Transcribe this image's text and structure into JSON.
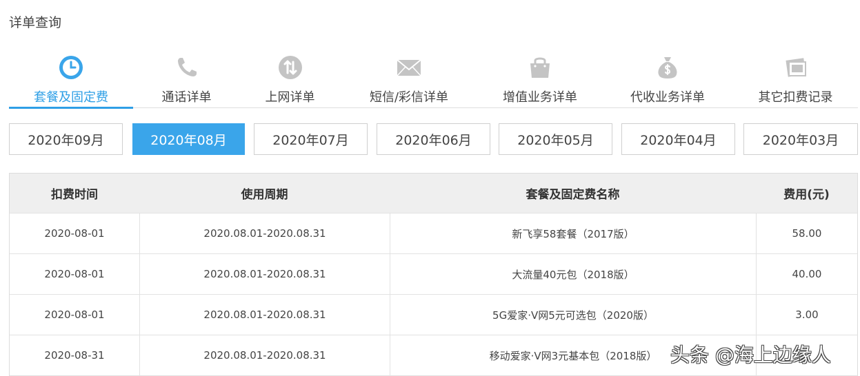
{
  "page_title": "详单查询",
  "tabs": [
    {
      "label": "套餐及固定费",
      "icon": "clock-icon",
      "active": true
    },
    {
      "label": "通话详单",
      "icon": "phone-icon",
      "active": false
    },
    {
      "label": "上网详单",
      "icon": "data-transfer-icon",
      "active": false
    },
    {
      "label": "短信/彩信详单",
      "icon": "envelope-icon",
      "active": false
    },
    {
      "label": "增值业务详单",
      "icon": "shopping-bag-icon",
      "active": false
    },
    {
      "label": "代收业务详单",
      "icon": "money-bag-icon",
      "active": false
    },
    {
      "label": "其它扣费记录",
      "icon": "receipt-icon",
      "active": false
    }
  ],
  "months": [
    {
      "label": "2020年09月",
      "active": false
    },
    {
      "label": "2020年08月",
      "active": true
    },
    {
      "label": "2020年07月",
      "active": false
    },
    {
      "label": "2020年06月",
      "active": false
    },
    {
      "label": "2020年05月",
      "active": false
    },
    {
      "label": "2020年04月",
      "active": false
    },
    {
      "label": "2020年03月",
      "active": false
    }
  ],
  "table": {
    "headers": [
      "扣费时间",
      "使用周期",
      "套餐及固定费名称",
      "费用(元)"
    ],
    "rows": [
      [
        "2020-08-01",
        "2020.08.01-2020.08.31",
        "新飞享58套餐（2017版）",
        "58.00"
      ],
      [
        "2020-08-01",
        "2020.08.01-2020.08.31",
        "大流量40元包（2018版）",
        "40.00"
      ],
      [
        "2020-08-01",
        "2020.08.01-2020.08.31",
        "5G爱家·V网5元可选包（2020版）",
        "3.00"
      ],
      [
        "2020-08-31",
        "2020.08.01-2020.08.31",
        "移动爱家·V网3元基本包（2018版）",
        ""
      ]
    ]
  },
  "watermark": "头条 @海上边缘人",
  "colors": {
    "accent": "#3aa5ea",
    "icon_gray": "#c4c4c4",
    "header_bg": "#efefef"
  }
}
